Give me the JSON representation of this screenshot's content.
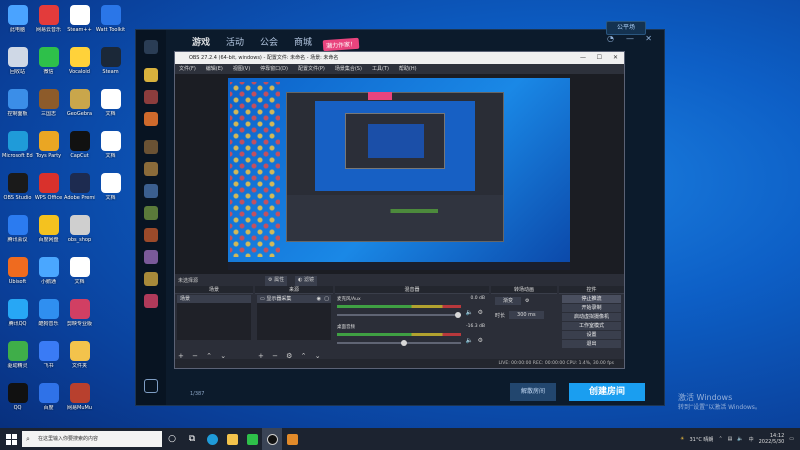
{
  "desktop": {
    "icons": [
      {
        "label": "此电脑",
        "color": "#4aa3ff"
      },
      {
        "label": "网易云音乐",
        "color": "#e33b3b"
      },
      {
        "label": "Steam++",
        "color": "#ffffff"
      },
      {
        "label": "Watt Toolkit",
        "color": "#2a76e8"
      },
      {
        "label": "回收站",
        "color": "#cfd8e6"
      },
      {
        "label": "微信",
        "color": "#2ec04a"
      },
      {
        "label": "Vocaloid",
        "color": "#ffd23a"
      },
      {
        "label": "Steam",
        "color": "#1b2838"
      },
      {
        "label": "控制面板",
        "color": "#3b8ee8"
      },
      {
        "label": "三国志",
        "color": "#8d5b2a"
      },
      {
        "label": "GeoGebra",
        "color": "#c9a64b"
      },
      {
        "label": "文档",
        "color": "#ffffff"
      },
      {
        "label": "Microsoft Edge",
        "color": "#1f9bd9"
      },
      {
        "label": "Toys Party",
        "color": "#eaa623"
      },
      {
        "label": "CapCut",
        "color": "#111111"
      },
      {
        "label": "文档",
        "color": "#ffffff"
      },
      {
        "label": "OBS Studio",
        "color": "#1a1a1a"
      },
      {
        "label": "WPS Office",
        "color": "#d9312c"
      },
      {
        "label": "Adobe Premiere",
        "color": "#1d2b50"
      },
      {
        "label": "文档",
        "color": "#ffffff"
      },
      {
        "label": "腾讯会议",
        "color": "#2b7bf0"
      },
      {
        "label": "百度网盘",
        "color": "#f4c21f"
      },
      {
        "label": "obs_shop",
        "color": "#cfcfcf"
      },
      {
        "label": "",
        "color": "#0000"
      },
      {
        "label": "Ubisoft",
        "color": "#ef6b1f"
      },
      {
        "label": "小鹅通",
        "color": "#4aa7ff"
      },
      {
        "label": "文档",
        "color": "#ffffff"
      },
      {
        "label": "",
        "color": "#0000"
      },
      {
        "label": "腾讯QQ",
        "color": "#27a7f5"
      },
      {
        "label": "酷狗音乐",
        "color": "#2f8ff0"
      },
      {
        "label": "剪映专业版",
        "color": "#d13f63"
      },
      {
        "label": "",
        "color": "#0000"
      },
      {
        "label": "驱动精灵",
        "color": "#3fae49"
      },
      {
        "label": "飞书",
        "color": "#3a7bf5"
      },
      {
        "label": "文件夹",
        "color": "#f3c34c"
      },
      {
        "label": "",
        "color": "#0000"
      },
      {
        "label": "QQ",
        "color": "#111"
      },
      {
        "label": "百度",
        "color": "#2f72e8"
      },
      {
        "label": "网易MuMu",
        "color": "#b8402e"
      },
      {
        "label": "",
        "color": "#0000"
      }
    ]
  },
  "launcher": {
    "tabs": [
      "游戏",
      "活动",
      "公会",
      "商城"
    ],
    "promo_badge": "潮力作家！",
    "top_right_tag": "公平场",
    "page_indicator": "1/387",
    "cancel_label": "解散房间",
    "create_label": "创建房间"
  },
  "obs": {
    "title": "OBS 27.2.4 (64-bit, windows) - 配置文件: 未命名 - 场景: 未命名",
    "menu": [
      "文件(F)",
      "编辑(E)",
      "视图(V)",
      "停靠窗口(D)",
      "配置文件(P)",
      "场景集合(S)",
      "工具(T)",
      "帮助(H)"
    ],
    "no_source": "未选择源",
    "properties": "属性",
    "filters": "滤镜",
    "docks": {
      "scenes": {
        "header": "场景",
        "items": [
          "场景"
        ]
      },
      "sources": {
        "header": "来源",
        "items": [
          "显示器采集"
        ]
      },
      "mixer": {
        "header": "混音器",
        "channels": [
          {
            "name": "麦克风/Aux",
            "db": "0.0 dB"
          },
          {
            "name": "桌面音频",
            "db": "-16.3 dB"
          }
        ]
      },
      "transitions": {
        "header": "转场动画",
        "type": "渐变",
        "duration_label": "时长",
        "duration": "300 ms"
      },
      "controls": {
        "header": "控件",
        "buttons": [
          "停止推流",
          "开始录制",
          "启动虚拟摄像机",
          "工作室模式",
          "设置",
          "退出"
        ]
      }
    },
    "status": "LIVE: 00:00:00   REC: 00:00:00   CPU: 1.4%, 30.00 fps"
  },
  "watermark": {
    "line1": "激活 Windows",
    "line2": "转到“设置”以激活 Windows。"
  },
  "taskbar": {
    "search_placeholder": "在这里输入你要搜索的内容",
    "weather": "31°C 晴朗",
    "lang": "中",
    "time": "14:12",
    "date": "2022/5/30"
  }
}
